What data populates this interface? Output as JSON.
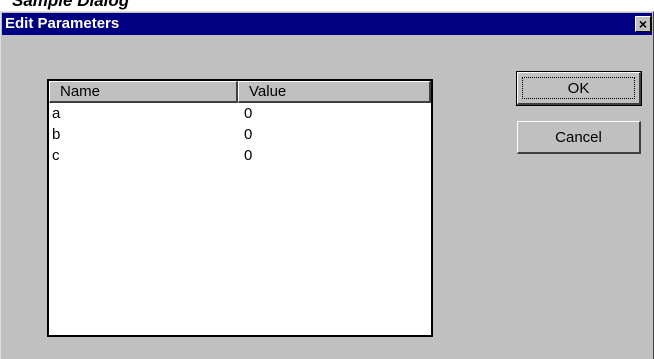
{
  "caption_partial": "Sample Dialog",
  "window": {
    "title": "Edit Parameters",
    "close_glyph": "×"
  },
  "table": {
    "columns": [
      "Name",
      "Value"
    ],
    "rows": [
      {
        "name": "a",
        "value": "0"
      },
      {
        "name": "b",
        "value": "0"
      },
      {
        "name": "c",
        "value": "0"
      }
    ]
  },
  "buttons": {
    "ok_label": "OK",
    "cancel_label": "Cancel"
  },
  "colors": {
    "titlebar": "#000080",
    "dialog_face": "#c0c0c0",
    "list_background": "#ffffff"
  }
}
